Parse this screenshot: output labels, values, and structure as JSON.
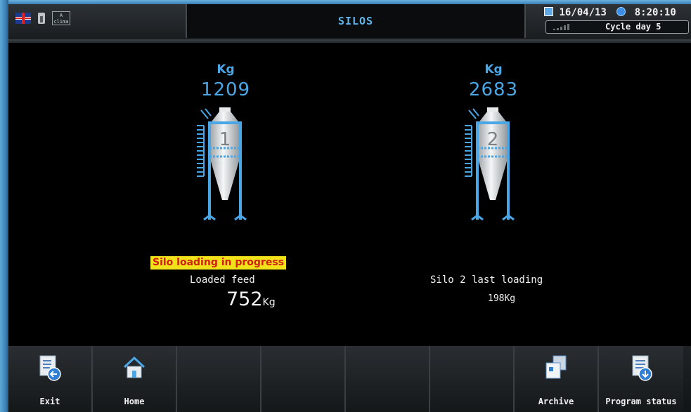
{
  "header": {
    "title": "SILOS",
    "date": "16/04/13",
    "time": "8:20:10",
    "cycle": "Cycle day 5",
    "climate_label": "A",
    "climate_sub": "clima"
  },
  "silos": [
    {
      "unit": "Kg",
      "weight": "1209",
      "number": "1"
    },
    {
      "unit": "Kg",
      "weight": "2683",
      "number": "2"
    }
  ],
  "status": {
    "banner": "Silo loading in progress",
    "loaded_label": "Loaded feed",
    "loaded_value": "752",
    "loaded_unit": "Kg",
    "last_label": "Silo 2 last loading",
    "last_value": "198Kg"
  },
  "toolbar": {
    "exit": "Exit",
    "home": "Home",
    "archive": "Archive",
    "program_status": "Program status"
  },
  "colors": {
    "accent": "#4aa6e4",
    "banner_bg": "#f2e21a",
    "banner_text": "#d02010"
  }
}
